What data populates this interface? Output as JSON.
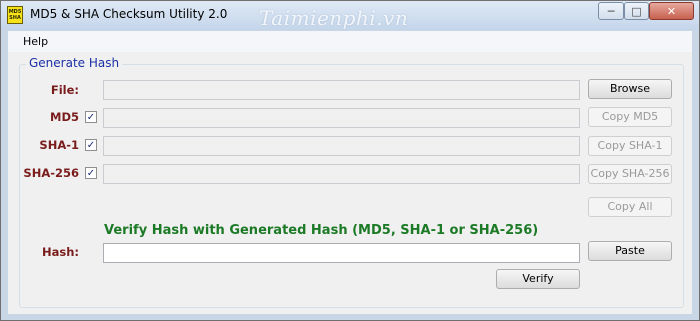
{
  "window": {
    "title": "MD5 & SHA Checksum Utility 2.0",
    "icon_text": "MD5 SHA",
    "watermark": "Taimienphi.vn"
  },
  "caption_buttons": {
    "minimize": "─",
    "maximize": "□",
    "close": "✕"
  },
  "menu": {
    "items": [
      {
        "label": "Help"
      }
    ]
  },
  "generate": {
    "title": "Generate Hash",
    "file_label": "File:",
    "file_value": "",
    "browse_label": "Browse",
    "rows": [
      {
        "label": "MD5",
        "checked": true,
        "value": "",
        "copy_label": "Copy MD5"
      },
      {
        "label": "SHA-1",
        "checked": true,
        "value": "",
        "copy_label": "Copy SHA-1"
      },
      {
        "label": "SHA-256",
        "checked": true,
        "value": "",
        "copy_label": "Copy SHA-256"
      }
    ],
    "copy_all_label": "Copy All"
  },
  "verify": {
    "heading": "Verify Hash with Generated Hash (MD5, SHA-1 or SHA-256)",
    "hash_label": "Hash:",
    "hash_value": "",
    "paste_label": "Paste",
    "verify_label": "Verify"
  },
  "colors": {
    "label": "#7a1c1c",
    "group_title": "#1c2fa6",
    "verify_heading": "#1c7a26"
  }
}
